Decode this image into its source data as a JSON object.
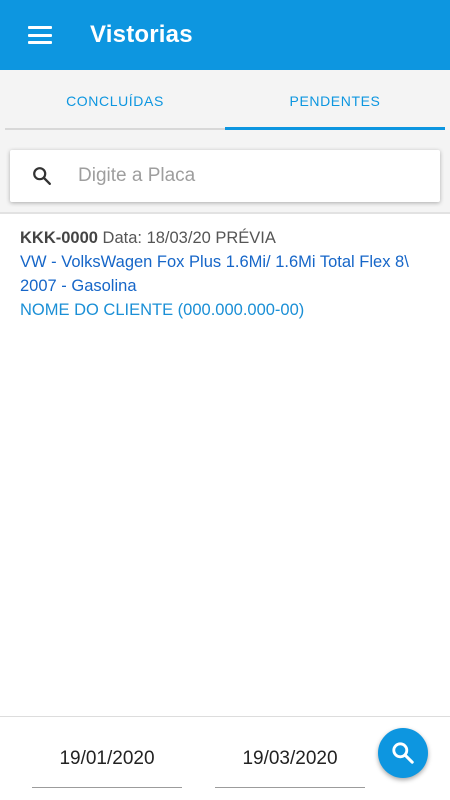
{
  "appbar": {
    "title": "Vistorias",
    "menu_icon": "menu-icon"
  },
  "tabs": [
    {
      "label": "CONCLUÍDAS",
      "active": false
    },
    {
      "label": "PENDENTES",
      "active": true
    }
  ],
  "search": {
    "placeholder": "Digite a Placa",
    "value": "",
    "icon": "search-icon"
  },
  "list": [
    {
      "plate": "KKK-0000",
      "date_label": "Data: 18/03/20 PRÉVIA",
      "vehicle_line1": "VW - VolksWagen Fox Plus 1.6Mi/ 1.6Mi Total Flex 8\\",
      "vehicle_line2": "2007 - Gasolina",
      "client": "NOME DO CLIENTE (000.000.000-00)"
    }
  ],
  "filters": {
    "start_date": "19/01/2020",
    "end_date": "19/03/2020",
    "fab_icon": "search-icon"
  },
  "colors": {
    "primary": "#0d96e0",
    "link_blue": "#1666c8",
    "client_blue": "#1a8fd6"
  }
}
